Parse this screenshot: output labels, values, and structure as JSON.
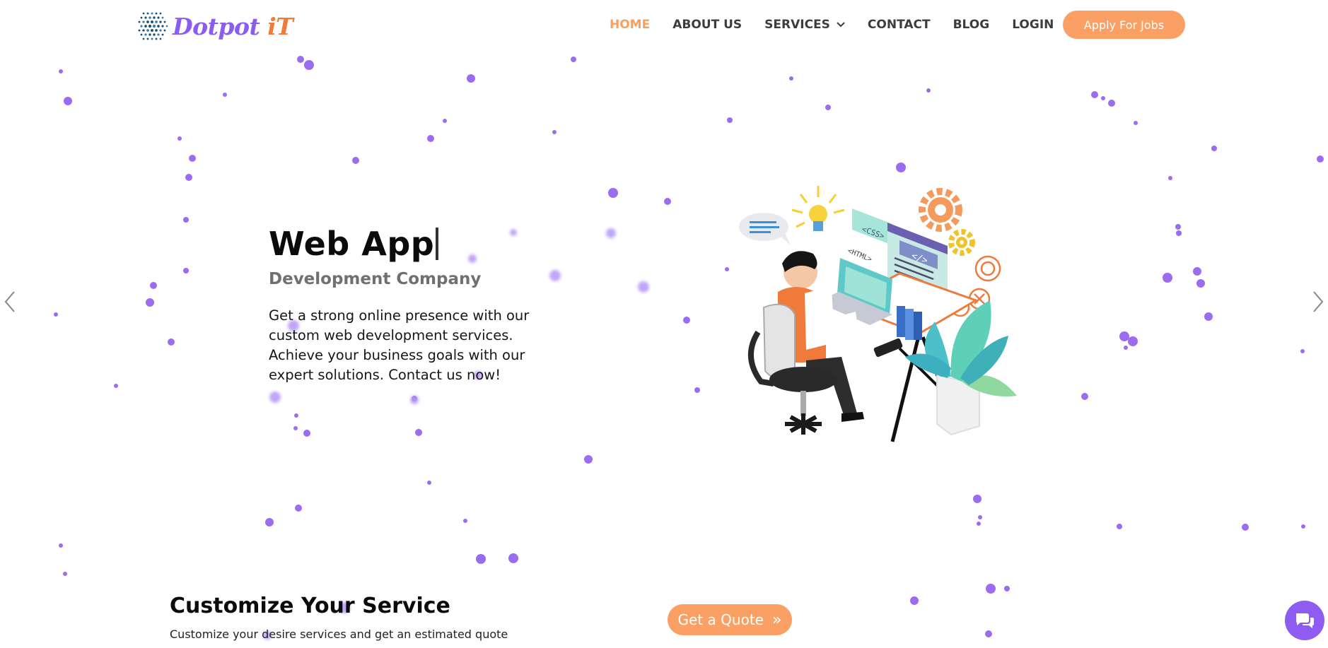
{
  "brand": {
    "name_part1": "Dotpot ",
    "name_part2": "iT",
    "colors": {
      "purple": "#8b5cf0",
      "orange": "#f07a3a",
      "accent_button": "#fba064",
      "particle": "#9b6cf0"
    }
  },
  "nav": {
    "items": [
      {
        "label": "HOME",
        "active": true
      },
      {
        "label": "ABOUT US",
        "active": false
      },
      {
        "label": "SERVICES",
        "active": false,
        "has_dropdown": true
      },
      {
        "label": "CONTACT",
        "active": false
      },
      {
        "label": "BLOG",
        "active": false
      },
      {
        "label": "LOGIN",
        "active": false
      }
    ],
    "apply_button": "Apply For Jobs"
  },
  "hero": {
    "title": "Web App",
    "subtitle": "Development Company",
    "description": "Get a strong online presence with our custom web development services. Achieve your business goals with our expert solutions. Contact us now!",
    "illustration_tags": [
      "<CSS>",
      "<HTML>",
      "</>"
    ]
  },
  "customize": {
    "title": "Customize Your Service",
    "subtitle": "Customize your desire services and get an estimated quote",
    "quote_button": "Get a Quote"
  },
  "icons": {
    "slider_prev": "chevron-left-icon",
    "slider_next": "chevron-right-icon",
    "chat": "chat-bubbles-icon",
    "quote_arrow": "double-chevron-right-icon"
  }
}
